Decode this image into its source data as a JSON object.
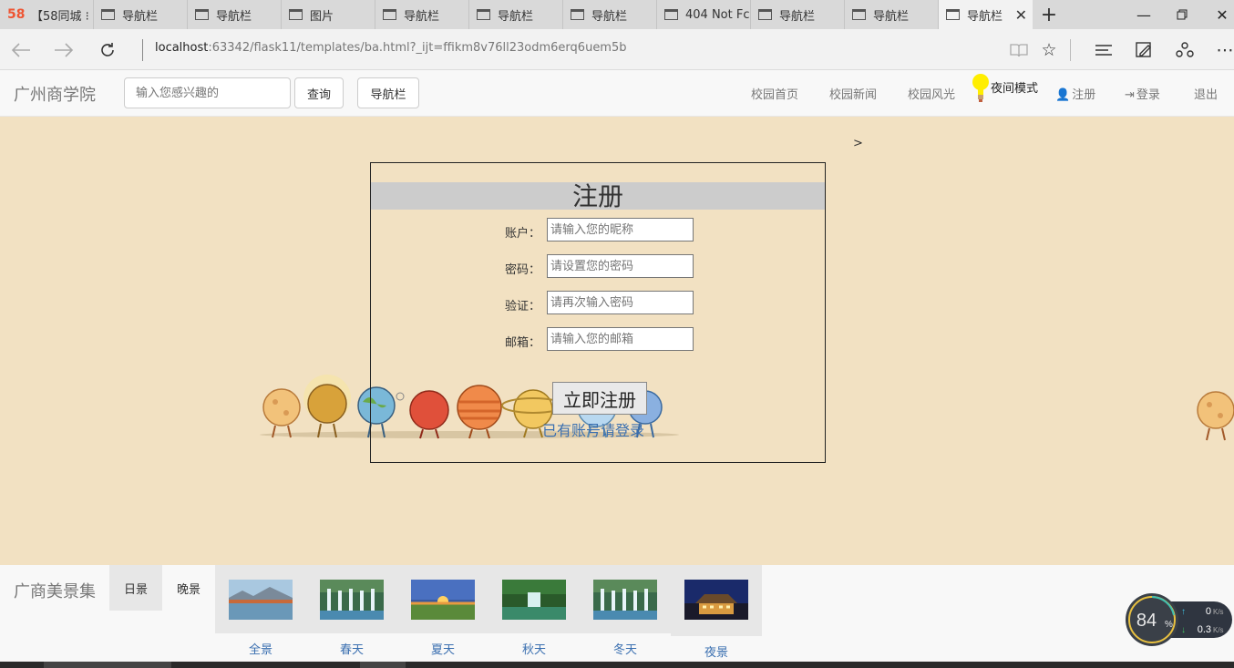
{
  "browser": {
    "tabs": [
      {
        "title": "【58同城 ⁝",
        "icon": "site-58-icon",
        "favicon_text": "58"
      },
      {
        "title": "导航栏",
        "icon": "page-icon"
      },
      {
        "title": "导航栏",
        "icon": "page-icon"
      },
      {
        "title": "图片",
        "icon": "page-icon"
      },
      {
        "title": "导航栏",
        "icon": "page-icon"
      },
      {
        "title": "导航栏",
        "icon": "page-icon"
      },
      {
        "title": "导航栏",
        "icon": "page-icon"
      },
      {
        "title": "404 Not Fc",
        "icon": "page-icon"
      },
      {
        "title": "导航栏",
        "icon": "page-icon"
      },
      {
        "title": "导航栏",
        "icon": "page-icon"
      },
      {
        "title": "导航栏",
        "icon": "page-icon",
        "active": true
      }
    ],
    "url_host": "localhost",
    "url_rest": ":63342/flask11/templates/ba.html?_ijt=ffikm8v76ll23odm6erq6uem5b"
  },
  "navbar": {
    "brand": "广州商学院",
    "search_placeholder": "输入您感兴趣的",
    "search_button": "查询",
    "nav_button": "导航栏",
    "links": {
      "home": "校园首页",
      "news": "校园新闻",
      "scenery": "校园风光",
      "night_mode": "夜间模式",
      "register": "注册",
      "login": "登录",
      "logout": "退出"
    }
  },
  "main": {
    "arrow": ">"
  },
  "register_form": {
    "title": "注册",
    "fields": [
      {
        "label": "账户：",
        "placeholder": "请输入您的昵称"
      },
      {
        "label": "密码：",
        "placeholder": "请设置您的密码"
      },
      {
        "label": "验证：",
        "placeholder": "请再次输入密码"
      },
      {
        "label": "邮箱：",
        "placeholder": "请输入您的邮箱"
      }
    ],
    "submit": "立即注册",
    "login_link": "已有账号请登录"
  },
  "gallery": {
    "brand": "广商美景集",
    "tabs": [
      "日景",
      "晚景"
    ],
    "items": [
      {
        "label": "全景"
      },
      {
        "label": "春天"
      },
      {
        "label": "夏天"
      },
      {
        "label": "秋天"
      },
      {
        "label": "冬天"
      },
      {
        "label": "夜景"
      }
    ]
  },
  "net_widget": {
    "percent": "84",
    "percent_unit": "%",
    "up": "0",
    "down": "0.3",
    "unit": "K/s"
  },
  "colors": {
    "page_background": "#f2e1c2",
    "link_blue": "#3a6fb0",
    "navbar_bg": "#f8f8f8"
  }
}
